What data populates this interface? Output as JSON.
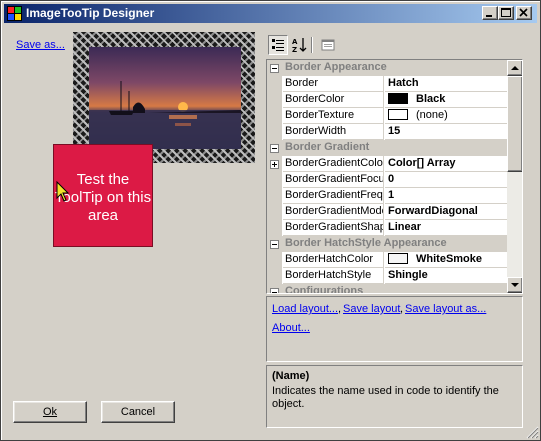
{
  "window": {
    "title": "ImageTooTip Designer",
    "app_icon": "app-icon"
  },
  "titlebar_buttons": {
    "minimize": "minimize-icon",
    "maximize": "maximize-icon",
    "close": "close-icon"
  },
  "left": {
    "save_as_link": "Save as...",
    "tooltip_area_text": "Test the ToolTip on this area",
    "tooltip_area_color": "#dc1a45",
    "ok_button": "Ok",
    "cancel_button": "Cancel"
  },
  "grid": {
    "toolbar": [
      "categorized-icon",
      "alphabetical-icon",
      "property-pages-icon"
    ],
    "rows": [
      {
        "type": "category",
        "name": "Border Appearance"
      },
      {
        "type": "property",
        "name": "Border",
        "value": "Hatch"
      },
      {
        "type": "property",
        "name": "BorderColor",
        "value": "Black",
        "swatch": "#000000"
      },
      {
        "type": "property",
        "name": "BorderTexture",
        "value": "(none)",
        "swatch": "#ffffff",
        "normal": true
      },
      {
        "type": "property",
        "name": "BorderWidth",
        "value": "15"
      },
      {
        "type": "category",
        "name": "Border Gradient"
      },
      {
        "type": "property",
        "name": "BorderGradientColors",
        "value": "Color[] Array",
        "expandable": true
      },
      {
        "type": "property",
        "name": "BorderGradientFocus",
        "value": "0"
      },
      {
        "type": "property",
        "name": "BorderGradientFrequency",
        "value": "1"
      },
      {
        "type": "property",
        "name": "BorderGradientMode",
        "value": "ForwardDiagonal"
      },
      {
        "type": "property",
        "name": "BorderGradientShape",
        "value": "Linear"
      },
      {
        "type": "category",
        "name": "Border HatchStyle Appearance"
      },
      {
        "type": "property",
        "name": "BorderHatchColor",
        "value": "WhiteSmoke",
        "swatch": "#f5f5f5"
      },
      {
        "type": "property",
        "name": "BorderHatchStyle",
        "value": "Shingle"
      },
      {
        "type": "category",
        "name": "Configurations"
      }
    ],
    "commands": [
      "Load layout...",
      "Save layout",
      "Save layout as...",
      "About..."
    ],
    "help_title": "(Name)",
    "help_description": "Indicates the name used in code to identify the object."
  }
}
